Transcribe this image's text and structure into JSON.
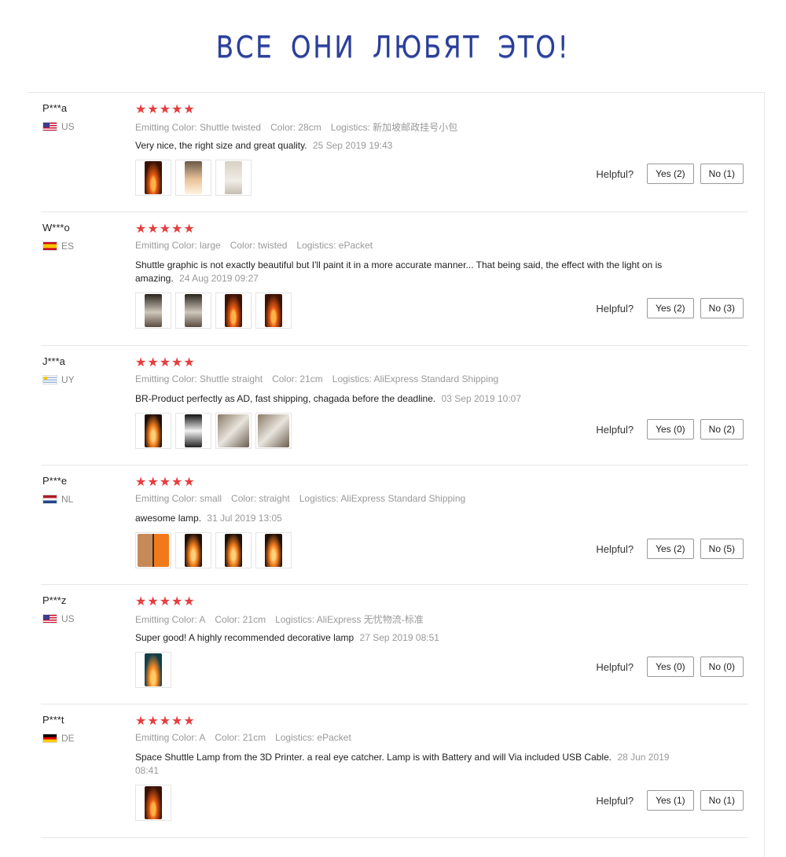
{
  "banner": {
    "title": "ВСЕ ОНИ ЛЮБЯТ ЭТО!"
  },
  "helpful_label": "Helpful?",
  "reviews": [
    {
      "user": "P***a",
      "country": "US",
      "flag": "us",
      "rating": "★★★★★",
      "attrs": [
        "Emitting Color: Shuttle twisted",
        "Color: 28cm",
        "Logistics: 新加坡邮政挂号小包"
      ],
      "text": "Very nice, the right size and great quality.",
      "date": "25 Sep 2019 19:43",
      "photos": [
        "fire",
        "warm",
        "pale"
      ],
      "yes": "Yes (2)",
      "no": "No (1)"
    },
    {
      "user": "W***o",
      "country": "ES",
      "flag": "es",
      "rating": "★★★★★",
      "attrs": [
        "Emitting Color: large",
        "Color: twisted",
        "Logistics: ePacket"
      ],
      "text": "Shuttle graphic is not exactly beautiful but I'll paint it in a more accurate manner... That being said, the effect with the light on is amazing.",
      "date": "24 Aug 2019 09:27",
      "photos": [
        "dark",
        "dark",
        "fire",
        "fire"
      ],
      "yes": "Yes (2)",
      "no": "No (3)"
    },
    {
      "user": "J***a",
      "country": "UY",
      "flag": "uy",
      "rating": "★★★★★",
      "attrs": [
        "Emitting Color: Shuttle straight",
        "Color: 21cm",
        "Logistics: AliExpress Standard Shipping"
      ],
      "text": "BR-Product perfectly as AD, fast shipping, chagada before the deadline.",
      "date": "03 Sep 2019 10:07",
      "photos": [
        "flame",
        "bw",
        "box",
        "box"
      ],
      "yes": "Yes (0)",
      "no": "No (2)"
    },
    {
      "user": "P***e",
      "country": "NL",
      "flag": "nl",
      "rating": "★★★★★",
      "attrs": [
        "Emitting Color: small",
        "Color: straight",
        "Logistics: AliExpress Standard Shipping"
      ],
      "text": "awesome lamp.",
      "date": "31 Jul 2019 13:05",
      "photos": [
        "pair",
        "flame",
        "flame",
        "flame"
      ],
      "yes": "Yes (2)",
      "no": "No (5)"
    },
    {
      "user": "P***z",
      "country": "US",
      "flag": "us",
      "rating": "★★★★★",
      "attrs": [
        "Emitting Color: A",
        "Color: 21cm",
        "Logistics: AliExpress 无忧物流-标准"
      ],
      "text": "Super good! A highly recommended decorative lamp",
      "date": "27 Sep 2019 08:51",
      "photos": [
        "teal"
      ],
      "yes": "Yes (0)",
      "no": "No (0)"
    },
    {
      "user": "P***t",
      "country": "DE",
      "flag": "de",
      "rating": "★★★★★",
      "attrs": [
        "Emitting Color: A",
        "Color: 21cm",
        "Logistics: ePacket"
      ],
      "text": "Space Shuttle Lamp from the 3D Printer. a real eye catcher. Lamp is with Battery and will Via included USB Cable.",
      "date": "28 Jun 2019 08:41",
      "photos": [
        "fire"
      ],
      "yes": "Yes (1)",
      "no": "No (1)"
    }
  ]
}
